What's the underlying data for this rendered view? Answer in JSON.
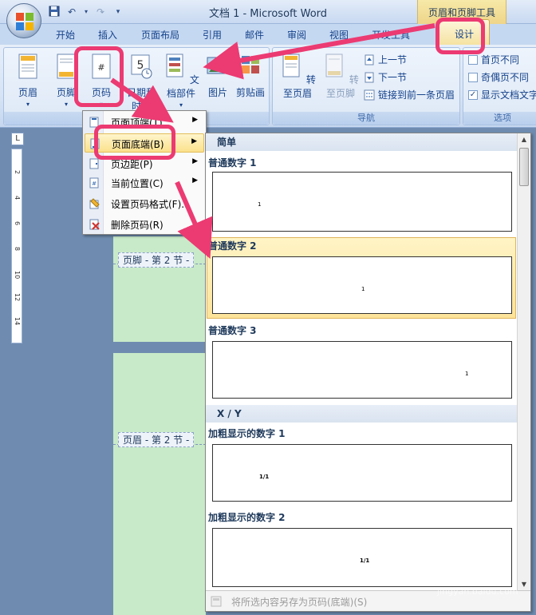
{
  "window": {
    "title": "文档 1 - Microsoft Word",
    "context_title": "页眉和页脚工具"
  },
  "tabs": [
    {
      "label": "开始"
    },
    {
      "label": "插入"
    },
    {
      "label": "页面布局"
    },
    {
      "label": "引用"
    },
    {
      "label": "邮件"
    },
    {
      "label": "审阅"
    },
    {
      "label": "视图"
    },
    {
      "label": "开发工具"
    },
    {
      "label": "设计"
    }
  ],
  "ribbon": {
    "groups": {
      "header_footer": "页眉和页脚",
      "navigation": "导航",
      "options": "选项"
    },
    "buttons": {
      "header": "页眉",
      "footer": "页脚",
      "page_number": "页码",
      "date_time_line1": "日期和",
      "date_time_line2": "时间",
      "quick_parts": "文档部件",
      "picture": "图片",
      "clip_art": "剪贴画",
      "goto_header": "转至页眉",
      "goto_footer": "转至页脚",
      "previous": "上一节",
      "next": "下一节",
      "link_previous": "链接到前一条页眉",
      "first_page_diff": "首页不同",
      "odd_even_diff": "奇偶页不同",
      "show_doc_text": "显示文档文字"
    }
  },
  "menu": {
    "items": [
      {
        "label": "页面顶端(T)"
      },
      {
        "label": "页面底端(B)"
      },
      {
        "label": "页边距(P)"
      },
      {
        "label": "当前位置(C)"
      },
      {
        "label": "设置页码格式(F)..."
      },
      {
        "label": "删除页码(R)"
      }
    ]
  },
  "document": {
    "footer_label": "页脚 - 第 2 节 -",
    "header_label": "页眉 - 第 2 节 -",
    "ruler_marks": [
      "2",
      "4",
      "6",
      "8",
      "10",
      "12",
      "14"
    ]
  },
  "gallery": {
    "categories": [
      "简单",
      "X / Y"
    ],
    "items": [
      {
        "name": "普通数字 1",
        "sample": "1"
      },
      {
        "name": "普通数字 2",
        "sample": "1"
      },
      {
        "name": "普通数字 3",
        "sample": "1"
      },
      {
        "name": "加粗显示的数字 1",
        "sample": "1/1"
      },
      {
        "name": "加粗显示的数字 2",
        "sample": "1/1"
      }
    ],
    "footer_action": "将所选内容另存为页码(底端)(S)"
  },
  "watermark": {
    "text": "Baidu经验",
    "sub": "jingyan.baidu.com"
  },
  "colors": {
    "annotation": "#ec3a72",
    "ribbon_bg": "#dde8f6",
    "page_green": "#c9eac8"
  }
}
